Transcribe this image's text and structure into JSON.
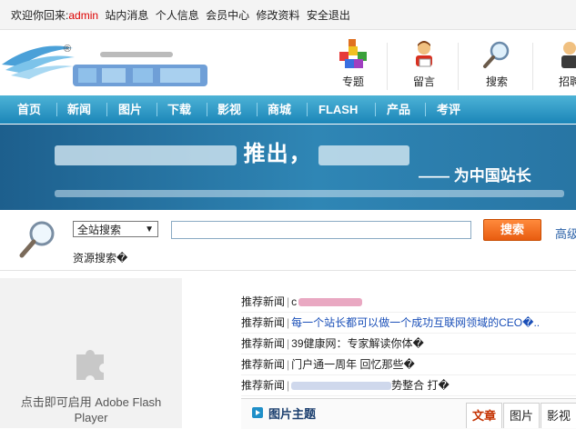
{
  "topbar": {
    "welcome": "欢迎你回来:",
    "username": "admin",
    "links": [
      "站内消息",
      "个人信息",
      "会员中心",
      "修改资料",
      "安全退出"
    ]
  },
  "header": {
    "quick_links": [
      {
        "label": "专题",
        "icon": "cubes-icon"
      },
      {
        "label": "留言",
        "icon": "person-chat-icon"
      },
      {
        "label": "搜索",
        "icon": "magnifier-icon"
      },
      {
        "label": "招聘",
        "icon": "person-icon"
      }
    ]
  },
  "nav": {
    "items": [
      "首页",
      "新闻",
      "图片",
      "下载",
      "影视",
      "商城",
      "FLASH",
      "产品",
      "考评"
    ]
  },
  "banner": {
    "line1_visible": "推出，",
    "line2": "—— 为中国站长"
  },
  "search": {
    "scope_selected": "全站搜索",
    "keyword_value": "",
    "button_label": "搜索",
    "advanced_label": "高级",
    "resource_label": "资源搜索�"
  },
  "flash": {
    "placeholder_text": "点击即可启用 Adobe Flash Player"
  },
  "news": {
    "label": "推荐新闻",
    "items": [
      {
        "title": "c",
        "suffix": "",
        "style": "redblur"
      },
      {
        "title": "每一个站长都可以做一个成功互联网领域的CEO�..",
        "suffix": "",
        "style": "blue"
      },
      {
        "title": "39健康网：专家解读你体�",
        "suffix": "",
        "style": "plain"
      },
      {
        "title": "门户通一周年 回忆那些�",
        "suffix": "",
        "style": "plain"
      },
      {
        "title": "",
        "suffix": "势整合 打�",
        "style": "grayblur"
      }
    ]
  },
  "picpanel": {
    "title": "图片主题",
    "tabs": [
      "文章",
      "图片",
      "影视"
    ],
    "active_tab": 0
  },
  "colors": {
    "nav_top": "#4db3d6",
    "nav_bottom": "#1b85b8",
    "search_button": "#f07020",
    "link_blue": "#1a4fb8",
    "username_red": "#dd0000"
  }
}
